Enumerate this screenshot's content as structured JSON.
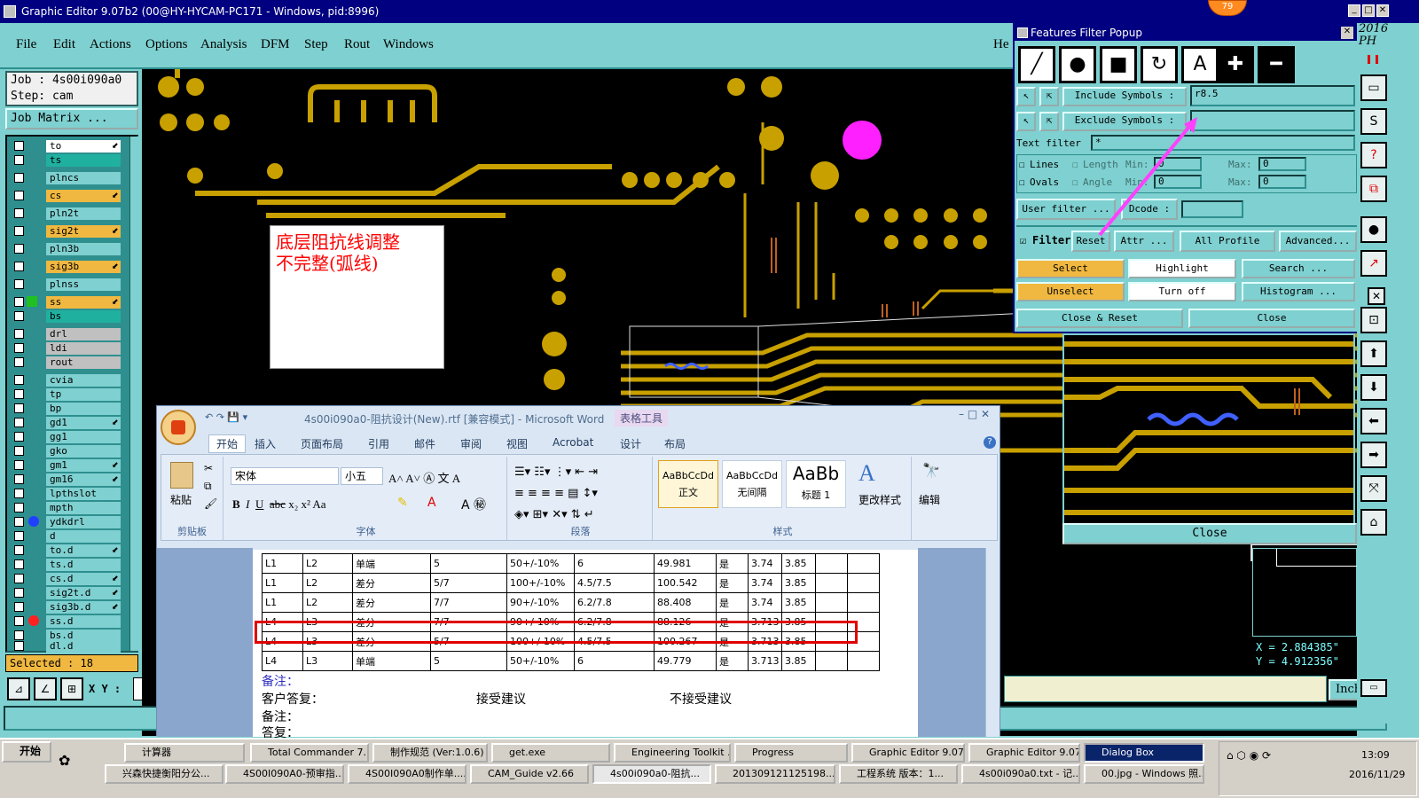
{
  "window": {
    "title": "Graphic Editor 9.07b2 (00@HY-HYCAM-PC171 - Windows, pid:8996)",
    "badge": "79",
    "year_label": "2016",
    "ph_label": "PH"
  },
  "menu": {
    "file": "File",
    "edit": "Edit",
    "actions": "Actions",
    "options": "Options",
    "analysis": "Analysis",
    "dfm": "DFM",
    "step": "Step",
    "rout": "Rout",
    "windows": "Windows",
    "help": "He"
  },
  "job": {
    "job_line": "Job : 4s00i090a0",
    "step_line": "Step: cam",
    "matrix_button": "Job Matrix ...",
    "selected": "Selected : 18",
    "xy_label": "X Y :"
  },
  "layers": [
    {
      "name": "to",
      "color": "#ffffff",
      "arrow": true
    },
    {
      "name": "ts",
      "color": "#20b0a0",
      "arrow": false
    },
    {
      "name": "plncs",
      "color": "#7fd0d0",
      "arrow": false
    },
    {
      "name": "cs",
      "color": "#f0b840",
      "arrow": true
    },
    {
      "name": "pln2t",
      "color": "#7fd0d0",
      "arrow": false
    },
    {
      "name": "sig2t",
      "color": "#f0b840",
      "arrow": true
    },
    {
      "name": "pln3b",
      "color": "#7fd0d0",
      "arrow": false
    },
    {
      "name": "sig3b",
      "color": "#f0b840",
      "arrow": true
    },
    {
      "name": "plnss",
      "color": "#7fd0d0",
      "arrow": false
    },
    {
      "name": "ss",
      "color": "#f0b840",
      "arrow": true
    },
    {
      "name": "bs",
      "color": "#20b0a0",
      "arrow": false
    },
    {
      "name": "drl",
      "color": "#c0c0c0",
      "arrow": false
    },
    {
      "name": "ldi",
      "color": "#c0c0c0",
      "arrow": false
    },
    {
      "name": "rout",
      "color": "#c0c0c0",
      "arrow": false
    },
    {
      "name": "cvia",
      "color": "#7fd0d0",
      "arrow": false
    },
    {
      "name": "tp",
      "color": "#7fd0d0",
      "arrow": false
    },
    {
      "name": "bp",
      "color": "#7fd0d0",
      "arrow": false
    },
    {
      "name": "gd1",
      "color": "#7fd0d0",
      "arrow": true
    },
    {
      "name": "gg1",
      "color": "#7fd0d0",
      "arrow": false
    },
    {
      "name": "gko",
      "color": "#7fd0d0",
      "arrow": false
    },
    {
      "name": "gm1",
      "color": "#7fd0d0",
      "arrow": true
    },
    {
      "name": "gm16",
      "color": "#7fd0d0",
      "arrow": true
    },
    {
      "name": "lpthslot",
      "color": "#7fd0d0",
      "arrow": false
    },
    {
      "name": "mpth",
      "color": "#7fd0d0",
      "arrow": false
    },
    {
      "name": "ydkdrl",
      "color": "#7fd0d0",
      "arrow": false
    },
    {
      "name": "d",
      "color": "#7fd0d0",
      "arrow": false
    },
    {
      "name": "to.d",
      "color": "#7fd0d0",
      "arrow": true
    },
    {
      "name": "ts.d",
      "color": "#7fd0d0",
      "arrow": false
    },
    {
      "name": "cs.d",
      "color": "#7fd0d0",
      "arrow": true
    },
    {
      "name": "sig2t.d",
      "color": "#7fd0d0",
      "arrow": true
    },
    {
      "name": "sig3b.d",
      "color": "#7fd0d0",
      "arrow": true
    },
    {
      "name": "ss.d",
      "color": "#7fd0d0",
      "arrow": false
    },
    {
      "name": "bs.d",
      "color": "#7fd0d0",
      "arrow": false
    },
    {
      "name": "dl.d",
      "color": "#7fd0d0",
      "arrow": false
    }
  ],
  "note": {
    "line1": "底层阻抗线调整",
    "line2": "不完整(弧线)"
  },
  "filter_popup": {
    "title": "Features Filter Popup",
    "include_label": "Include Symbols :",
    "include_value": "r8.5",
    "exclude_label": "Exclude Symbols :",
    "text_filter_label": "Text filter",
    "text_filter_value": "*",
    "lines": "Lines",
    "ovals": "Ovals",
    "length": "Length",
    "angle": "Angle",
    "min": "Min:",
    "max": "Max:",
    "zero": "0",
    "user_filter": "User filter ...",
    "dcode": "Dcode :",
    "filter": "Filter",
    "reset": "Reset",
    "attr": "Attr ...",
    "all_profile": "All Profile",
    "advanced": "Advanced...",
    "select": "Select",
    "highlight": "Highlight",
    "search": "Search ...",
    "unselect": "Unselect",
    "turn_off": "Turn off",
    "histogram": "Histogram ...",
    "close_reset": "Close & Reset",
    "close": "Close"
  },
  "zoom_panel": {
    "close": "Close",
    "x": "X = 2.884385\"",
    "y": "Y = 4.912356\"",
    "unit": "Inch"
  },
  "word": {
    "title": "4s00i090a0-阻抗设计(New).rtf [兼容模式] - Microsoft Word",
    "context_tab": "表格工具",
    "tabs": [
      "开始",
      "插入",
      "页面布局",
      "引用",
      "邮件",
      "审阅",
      "视图",
      "Acrobat",
      "设计",
      "布局"
    ],
    "groups": {
      "clipboard": "剪贴板",
      "font": "字体",
      "paragraph": "段落",
      "styles": "样式",
      "paste": "粘贴",
      "change_styles": "更改样式",
      "edit": "编辑"
    },
    "font_name": "宋体",
    "font_size": "小五",
    "styles": [
      {
        "sample": "AaBbCcDd",
        "name": "正文"
      },
      {
        "sample": "AaBbCcDd",
        "name": "无间隔"
      },
      {
        "sample": "AaBb",
        "name": "标题 1"
      }
    ],
    "table_rows": [
      [
        "L1",
        "L2",
        "单端",
        "5",
        "50+/-10%",
        "6",
        "49.981",
        "是",
        "3.74",
        "3.85"
      ],
      [
        "L1",
        "L2",
        "差分",
        "5/7",
        "100+/-10%",
        "4.5/7.5",
        "100.542",
        "是",
        "3.74",
        "3.85"
      ],
      [
        "L1",
        "L2",
        "差分",
        "7/7",
        "90+/-10%",
        "6.2/7.8",
        "88.408",
        "是",
        "3.74",
        "3.85"
      ],
      [
        "L4",
        "L3",
        "差分",
        "7/7",
        "90+/-10%",
        "6.2/7.8",
        "88.126",
        "是",
        "3.713",
        "3.85"
      ],
      [
        "L4",
        "L3",
        "差分",
        "5/7",
        "100+/-10%",
        "4.5/7.5",
        "100.267",
        "是",
        "3.713",
        "3.85"
      ],
      [
        "L4",
        "L3",
        "单端",
        "5",
        "50+/-10%",
        "6",
        "49.779",
        "是",
        "3.713",
        "3.85"
      ]
    ],
    "remark1": "备注：",
    "customer_reply": "客户答复：",
    "accept": "接受建议",
    "reject": "不接受建议",
    "remark2": "备注：",
    "reply": "答复："
  },
  "taskbar": {
    "start": "开始",
    "row1": [
      "计算器",
      "Total Commander 7....",
      "制作规范 (Ver:1.0.6)",
      "get.exe",
      "Engineering Toolkit ...",
      "Progress",
      "Graphic Editor 9.07...",
      "Graphic Editor 9.07...",
      "Dialog Box"
    ],
    "row2": [
      "兴森快捷衡阳分公...",
      "4S00I090A0-预审指...",
      "4S00I090A0制作单....",
      "CAM_Guide v2.66",
      "4s00i090a0-阻抗...",
      "201309121125198...",
      "工程系统  版本：1...",
      "4s00i090a0.txt - 记...",
      "00.jpg - Windows 照..."
    ],
    "time": "13:09",
    "date": "2016/11/29"
  }
}
